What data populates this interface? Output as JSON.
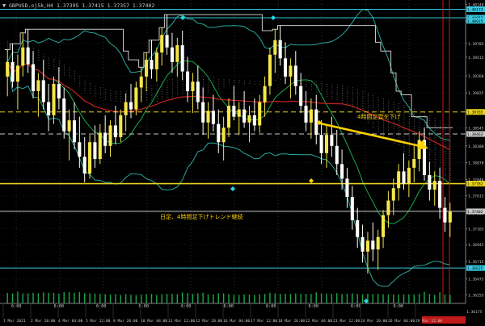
{
  "header": {
    "symbol_tf": "GBPUSD.oj5k,H4",
    "ohlc": "1.37395 1.37415 1.37357 1.37402"
  },
  "colors": {
    "background": "#000000",
    "bull": "#f5e64a",
    "bear": "#fffffa",
    "ma_red": "#c62222",
    "ma_green": "#1aa84a",
    "bb_teal": "#28a89c",
    "donchian": "#c8c8c8",
    "cloud": "#ffffff",
    "level_yellow": "#e8d41a",
    "level_cyan": "#38c8e0",
    "vline_red": "#c21a1a",
    "arrow": "#ffd200",
    "marker_cyan": "#24d8e8"
  },
  "annotations": {
    "arrow_label": "4時間足雲を下げ",
    "level_label": "日足、4時間足下げトレンド継続"
  },
  "price_scale": {
    "ticks": [
      "1.40240",
      "1.40015",
      "1.39705",
      "1.39515",
      "1.39260",
      "1.39025",
      "1.38765",
      "1.38545",
      "1.38300",
      "1.38070",
      "1.37840",
      "1.37615",
      "1.37380",
      "1.37165",
      "1.36945",
      "1.36715",
      "1.36475",
      "1.36255"
    ],
    "badges": [
      {
        "text": "1.40173",
        "bg": "#38c8e0",
        "fg": "#000000",
        "price": 1.40173
      },
      {
        "text": "1.40057",
        "bg": "#38c8e0",
        "fg": "#000000",
        "price": 1.40057
      },
      {
        "text": "1.40015",
        "bg": "#38c8e0",
        "fg": "#000000",
        "price": 1.40015
      },
      {
        "text": "1.38765",
        "bg": "#e8d41a",
        "fg": "#000000",
        "price": 1.38765
      },
      {
        "text": "1.38463",
        "bg": "#c8c8c8",
        "fg": "#000000",
        "price": 1.38463
      },
      {
        "text": "1.37782",
        "bg": "#e8d41a",
        "fg": "#000000",
        "price": 1.37782
      },
      {
        "text": "1.37402",
        "bg": "#c8c8c8",
        "fg": "#000000",
        "price": 1.37402
      },
      {
        "text": "1.36625",
        "bg": "#38c8e0",
        "fg": "#000000",
        "price": 1.36625
      }
    ],
    "red_badge": "1.36175"
  },
  "levels": [
    {
      "price": 1.40173,
      "color": "#38c8e0",
      "style": "solid"
    },
    {
      "price": 1.40057,
      "color": "#38c8e0",
      "style": "solid"
    },
    {
      "price": 1.38765,
      "color": "#e8d41a",
      "style": "dash"
    },
    {
      "price": 1.38463,
      "color": "#c8c8c8",
      "style": "dash"
    },
    {
      "price": 1.37782,
      "color": "#e8d41a",
      "style": "solid"
    },
    {
      "price": 1.37402,
      "color": "#c8c8c8",
      "style": "solid"
    },
    {
      "price": 1.36625,
      "color": "#38c8e0",
      "style": "solid"
    }
  ],
  "time_scale": {
    "labels": [
      "1 Mar 2021",
      "2 Mar 20:00",
      "4 Mar 04:00",
      "5 Mar 12:00",
      "8 Mar 20:00",
      "10 Mar 04:00",
      "11 Mar 12:00",
      "12 Mar 20:00",
      "16 Mar 04:00",
      "17 Mar 12:00",
      "18 Mar 20:00",
      "22 Mar 04:00",
      "23 Mar 12:00",
      "24 Mar 20:00",
      "26 Mar 04:00",
      "29 Mar 12:00"
    ],
    "session_labels": [
      "6:00",
      "6:00",
      "6:00",
      "6:00",
      "6:00",
      "6:00",
      "6:00",
      "6:00",
      "6:00",
      "6:00"
    ]
  },
  "chart_data": {
    "type": "candlestick",
    "symbol": "GBPUSD",
    "timeframe": "H4",
    "ylim": [
      1.3614,
      1.403
    ],
    "candles": [
      [
        1.3925,
        1.3962,
        1.3898,
        1.3945
      ],
      [
        1.3945,
        1.397,
        1.391,
        1.3918
      ],
      [
        1.3918,
        1.3955,
        1.388,
        1.394
      ],
      [
        1.394,
        1.3985,
        1.3925,
        1.3965
      ],
      [
        1.3965,
        1.399,
        1.393,
        1.3942
      ],
      [
        1.3942,
        1.396,
        1.3895,
        1.3905
      ],
      [
        1.3905,
        1.393,
        1.387,
        1.392
      ],
      [
        1.392,
        1.3948,
        1.388,
        1.389
      ],
      [
        1.389,
        1.3915,
        1.385,
        1.3872
      ],
      [
        1.3872,
        1.3925,
        1.386,
        1.3915
      ],
      [
        1.3915,
        1.3938,
        1.388,
        1.3895
      ],
      [
        1.3895,
        1.391,
        1.384,
        1.385
      ],
      [
        1.385,
        1.388,
        1.381,
        1.3865
      ],
      [
        1.3865,
        1.389,
        1.3825,
        1.3835
      ],
      [
        1.3835,
        1.387,
        1.38,
        1.3815
      ],
      [
        1.3815,
        1.3842,
        1.378,
        1.3792
      ],
      [
        1.3792,
        1.3845,
        1.3785,
        1.3835
      ],
      [
        1.3835,
        1.3858,
        1.38,
        1.3812
      ],
      [
        1.3812,
        1.386,
        1.3805,
        1.3848
      ],
      [
        1.3848,
        1.3872,
        1.382,
        1.383
      ],
      [
        1.383,
        1.3865,
        1.3815,
        1.3858
      ],
      [
        1.3858,
        1.3885,
        1.3832,
        1.3842
      ],
      [
        1.3842,
        1.388,
        1.3835,
        1.3872
      ],
      [
        1.3872,
        1.3902,
        1.385,
        1.389
      ],
      [
        1.389,
        1.3915,
        1.3868,
        1.388
      ],
      [
        1.388,
        1.3918,
        1.3872,
        1.391
      ],
      [
        1.391,
        1.3938,
        1.389,
        1.3925
      ],
      [
        1.3925,
        1.3958,
        1.3905,
        1.3948
      ],
      [
        1.3948,
        1.3975,
        1.3922,
        1.3935
      ],
      [
        1.3935,
        1.3965,
        1.3918,
        1.3958
      ],
      [
        1.3958,
        1.3992,
        1.394,
        1.3982
      ],
      [
        1.3982,
        1.401,
        1.3955,
        1.3965
      ],
      [
        1.3965,
        1.3985,
        1.393,
        1.3945
      ],
      [
        1.3945,
        1.3978,
        1.3925,
        1.3968
      ],
      [
        1.3968,
        1.3988,
        1.392,
        1.3932
      ],
      [
        1.3932,
        1.3952,
        1.389,
        1.3905
      ],
      [
        1.3905,
        1.393,
        1.3875,
        1.3918
      ],
      [
        1.3918,
        1.394,
        1.388,
        1.389
      ],
      [
        1.389,
        1.391,
        1.3845,
        1.3862
      ],
      [
        1.3862,
        1.389,
        1.384,
        1.3878
      ],
      [
        1.3878,
        1.39,
        1.385,
        1.386
      ],
      [
        1.386,
        1.388,
        1.382,
        1.3835
      ],
      [
        1.3835,
        1.387,
        1.381,
        1.3855
      ],
      [
        1.3855,
        1.3895,
        1.3842,
        1.3885
      ],
      [
        1.3885,
        1.3912,
        1.3865,
        1.387
      ],
      [
        1.387,
        1.389,
        1.3845,
        1.388
      ],
      [
        1.388,
        1.3905,
        1.3855,
        1.3862
      ],
      [
        1.3862,
        1.3885,
        1.3835,
        1.3872
      ],
      [
        1.3872,
        1.3895,
        1.385,
        1.3858
      ],
      [
        1.3858,
        1.39,
        1.3848,
        1.389
      ],
      [
        1.389,
        1.3925,
        1.387,
        1.3912
      ],
      [
        1.3912,
        1.3965,
        1.39,
        1.3955
      ],
      [
        1.3955,
        1.399,
        1.393,
        1.3975
      ],
      [
        1.3975,
        1.3995,
        1.394,
        1.395
      ],
      [
        1.395,
        1.3972,
        1.3915,
        1.3925
      ],
      [
        1.3925,
        1.395,
        1.3895,
        1.394
      ],
      [
        1.394,
        1.396,
        1.39,
        1.3912
      ],
      [
        1.3912,
        1.393,
        1.3875,
        1.3885
      ],
      [
        1.3885,
        1.3905,
        1.385,
        1.3862
      ],
      [
        1.3862,
        1.3895,
        1.384,
        1.388
      ],
      [
        1.388,
        1.39,
        1.3832,
        1.3845
      ],
      [
        1.3845,
        1.3865,
        1.3805,
        1.382
      ],
      [
        1.382,
        1.3858,
        1.38,
        1.3845
      ],
      [
        1.3845,
        1.387,
        1.3815,
        1.383
      ],
      [
        1.383,
        1.3852,
        1.379,
        1.3805
      ],
      [
        1.3805,
        1.3825,
        1.377,
        1.3785
      ],
      [
        1.3785,
        1.38,
        1.3745,
        1.376
      ],
      [
        1.376,
        1.3775,
        1.3715,
        1.3728
      ],
      [
        1.3728,
        1.3745,
        1.369,
        1.3705
      ],
      [
        1.3705,
        1.3722,
        1.367,
        1.3685
      ],
      [
        1.3685,
        1.3712,
        1.3655,
        1.37
      ],
      [
        1.37,
        1.3725,
        1.3672,
        1.3688
      ],
      [
        1.3688,
        1.3715,
        1.366,
        1.3705
      ],
      [
        1.3705,
        1.3742,
        1.369,
        1.3735
      ],
      [
        1.3735,
        1.3768,
        1.3718,
        1.3755
      ],
      [
        1.3755,
        1.3785,
        1.3735,
        1.3772
      ],
      [
        1.3772,
        1.3805,
        1.3755,
        1.3795
      ],
      [
        1.3795,
        1.382,
        1.377,
        1.3778
      ],
      [
        1.3778,
        1.381,
        1.376,
        1.38
      ],
      [
        1.38,
        1.383,
        1.378,
        1.3812
      ],
      [
        1.3812,
        1.385,
        1.3795,
        1.3838
      ],
      [
        1.3838,
        1.3855,
        1.3782,
        1.379
      ],
      [
        1.379,
        1.3808,
        1.3755,
        1.377
      ],
      [
        1.377,
        1.3795,
        1.3748,
        1.3782
      ],
      [
        1.3782,
        1.38,
        1.373,
        1.3745
      ],
      [
        1.3745,
        1.376,
        1.3712,
        1.3725
      ],
      [
        1.3725,
        1.3752,
        1.3705,
        1.374
      ]
    ]
  }
}
